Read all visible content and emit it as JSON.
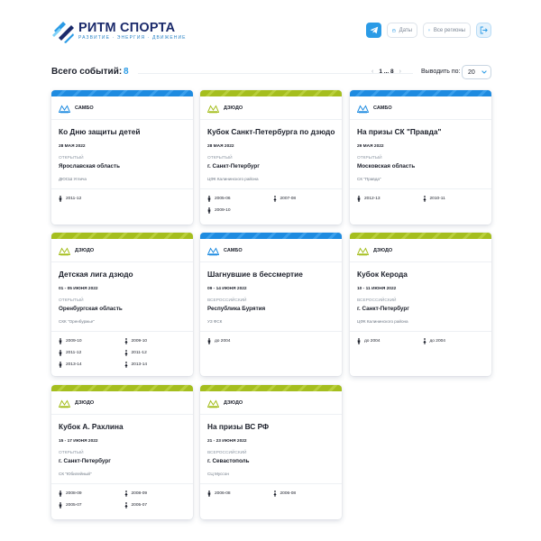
{
  "brand": {
    "name": "РИТМ СПОРТА",
    "tagline": "РАЗВИТИЕ · ЭНЕРГИЯ · ДВИЖЕНИЕ",
    "colors": {
      "primary": "#1b2a6b",
      "accent": "#2b9be6",
      "blue_band": "#1e8be0",
      "green_band": "#a5be1e"
    }
  },
  "header": {
    "telegram_icon": "telegram-icon",
    "date_filter": "Даты",
    "region_filter": "Все регионы",
    "exit_icon": "exit-icon"
  },
  "toolbar": {
    "total_label": "Всего событий:",
    "total_count": "8",
    "pager_prev": "‹",
    "pager_pages": "1 ... 8",
    "pager_next": "›",
    "perpage_label": "Выводить по:",
    "perpage_value": "20"
  },
  "events": [
    {
      "sport": "САМБО",
      "band": "blue",
      "title": "Ко Дню защиты детей",
      "date": "28 МАЯ 2022",
      "type": "ОТКРЫТЫЙ",
      "region": "Ярославская область",
      "venue": "ДЮСШ Углича",
      "ages": [
        {
          "gender": "male",
          "years": "2011-12"
        }
      ]
    },
    {
      "sport": "ДЗЮДО",
      "band": "green",
      "title": "Кубок Санкт-Петербурга по дзюдо",
      "date": "28 МАЯ 2022",
      "type": "ОТКРЫТЫЙ",
      "region": "г. Санкт-Петербург",
      "venue": "ЦФК Калининского района",
      "ages": [
        {
          "gender": "male",
          "years": "2005-06"
        },
        {
          "gender": "female",
          "years": "2007-08"
        },
        {
          "gender": "male",
          "years": "2009-10"
        }
      ]
    },
    {
      "sport": "САМБО",
      "band": "blue",
      "title": "На призы СК \"Правда\"",
      "date": "29 МАЯ 2022",
      "type": "ОТКРЫТЫЙ",
      "region": "Московская область",
      "venue": "СК \"Правда\"",
      "ages": [
        {
          "gender": "male",
          "years": "2012-13"
        },
        {
          "gender": "female",
          "years": "2010-11"
        }
      ]
    },
    {
      "sport": "ДЗЮДО",
      "band": "green",
      "title": "Детская лига дзюдо",
      "date": "01 - 05 ИЮНЯ 2022",
      "type": "ОТКРЫТЫЙ",
      "region": "Оренбургская область",
      "venue": "СКК \"Оренбуржье\"",
      "ages": [
        {
          "gender": "male",
          "years": "2009-10"
        },
        {
          "gender": "female",
          "years": "2009-10"
        },
        {
          "gender": "male",
          "years": "2011-12"
        },
        {
          "gender": "female",
          "years": "2011-12"
        },
        {
          "gender": "male",
          "years": "2013-14"
        },
        {
          "gender": "female",
          "years": "2013-14"
        }
      ]
    },
    {
      "sport": "САМБО",
      "band": "blue",
      "title": "Шагнувшие в бессмертие",
      "date": "09 - 14 ИЮНЯ 2022",
      "type": "ВСЕРОССИЙСКИЙ",
      "region": "Республика Бурятия",
      "venue": "УЗ ФСК",
      "ages": [
        {
          "gender": "male",
          "years": "до 2004"
        }
      ]
    },
    {
      "sport": "ДЗЮДО",
      "band": "green",
      "title": "Кубок Керода",
      "date": "10 - 11 ИЮНЯ 2022",
      "type": "ВСЕРОССИЙСКИЙ",
      "region": "г. Санкт-Петербург",
      "venue": "ЦФК Калининского района",
      "ages": [
        {
          "gender": "male",
          "years": "до 2004"
        },
        {
          "gender": "female",
          "years": "до 2004"
        }
      ]
    },
    {
      "sport": "ДЗЮДО",
      "band": "green",
      "title": "Кубок А. Рахлина",
      "date": "15 - 17 ИЮНЯ 2022",
      "type": "ОТКРЫТЫЙ",
      "region": "г. Санкт-Петербург",
      "venue": "СК \"Юбилейный\"",
      "ages": [
        {
          "gender": "male",
          "years": "2008-09"
        },
        {
          "gender": "female",
          "years": "2008-09"
        },
        {
          "gender": "male",
          "years": "2005-07"
        },
        {
          "gender": "female",
          "years": "2005-07"
        }
      ]
    },
    {
      "sport": "ДЗЮДО",
      "band": "green",
      "title": "На призы ВС РФ",
      "date": "21 - 23 ИЮНЯ 2022",
      "type": "ВСЕРОССИЙСКИЙ",
      "region": "г. Севастополь",
      "venue": "СЦ Муссон",
      "ages": [
        {
          "gender": "male",
          "years": "2006-08"
        },
        {
          "gender": "female",
          "years": "2006-08"
        }
      ]
    }
  ]
}
